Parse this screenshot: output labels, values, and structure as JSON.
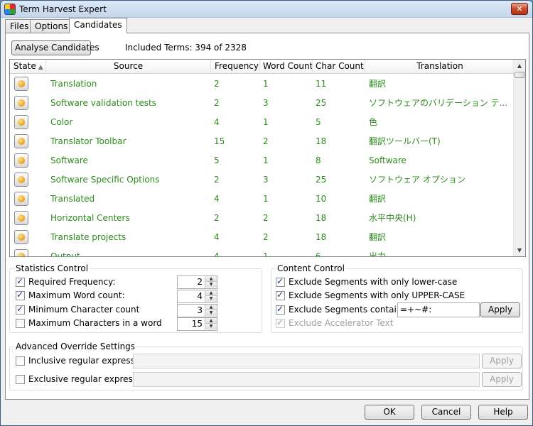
{
  "window": {
    "title": "Term Harvest Expert",
    "close_glyph": "✕"
  },
  "tabs": [
    {
      "label": "Files",
      "active": false
    },
    {
      "label": "Options",
      "active": false
    },
    {
      "label": "Candidates",
      "active": true
    }
  ],
  "toolbar": {
    "analyse_label": "Analyse Candidates",
    "included_terms": "Included Terms: 394 of 2328"
  },
  "grid": {
    "columns": [
      {
        "label": "State",
        "sorted": true
      },
      {
        "label": "Source"
      },
      {
        "label": "Frequency"
      },
      {
        "label": "Word Count"
      },
      {
        "label": "Char Count"
      },
      {
        "label": "Translation"
      }
    ],
    "sort_arrow": "▲",
    "rows": [
      {
        "source": "Translation",
        "frequency": "2",
        "word_count": "1",
        "char_count": "11",
        "translation": "翻訳"
      },
      {
        "source": "Software validation tests",
        "frequency": "2",
        "word_count": "3",
        "char_count": "25",
        "translation": "ソフトウェアのバリデーション テ..."
      },
      {
        "source": "Color",
        "frequency": "4",
        "word_count": "1",
        "char_count": "5",
        "translation": "色"
      },
      {
        "source": "Translator Toolbar",
        "frequency": "15",
        "word_count": "2",
        "char_count": "18",
        "translation": "翻訳ツールバー(T)"
      },
      {
        "source": "Software",
        "frequency": "5",
        "word_count": "1",
        "char_count": "8",
        "translation": "Software"
      },
      {
        "source": "Software Specific Options",
        "frequency": "2",
        "word_count": "3",
        "char_count": "25",
        "translation": "ソフトウェア オプション"
      },
      {
        "source": "Translated",
        "frequency": "4",
        "word_count": "1",
        "char_count": "10",
        "translation": "翻訳"
      },
      {
        "source": "Horizontal Centers",
        "frequency": "2",
        "word_count": "2",
        "char_count": "18",
        "translation": "水平中央(H)"
      },
      {
        "source": "Translate projects",
        "frequency": "4",
        "word_count": "2",
        "char_count": "18",
        "translation": "翻訳"
      },
      {
        "source": "Output",
        "frequency": "4",
        "word_count": "1",
        "char_count": "6",
        "translation": "出力"
      }
    ],
    "text_color": "#2d8a1c"
  },
  "statistics": {
    "title": "Statistics Control",
    "items": [
      {
        "label": "Required Frequency:",
        "checked": true,
        "value": "2"
      },
      {
        "label": "Maximum Word count:",
        "checked": true,
        "value": "4"
      },
      {
        "label": "Minimum Character count",
        "checked": true,
        "value": "3"
      },
      {
        "label": "Maximum Characters in a word",
        "checked": false,
        "value": "15"
      }
    ]
  },
  "content": {
    "title": "Content Control",
    "lower_label": "Exclude Segments with only lower-case",
    "upper_label": "Exclude Segments with only UPPER-CASE",
    "containing_label": "Exclude Segments containing",
    "containing_value": "=+~#:",
    "apply_label": "Apply",
    "accelerator_label": "Exclude Accelerator Text"
  },
  "advanced": {
    "title": "Advanced Override Settings",
    "inclusive_label": "Inclusive regular expression:",
    "exclusive_label": "Exclusive regular expression:",
    "inclusive_value": "",
    "exclusive_value": "",
    "apply_label": "Apply"
  },
  "footer": {
    "ok": "OK",
    "cancel": "Cancel",
    "help": "Help"
  }
}
